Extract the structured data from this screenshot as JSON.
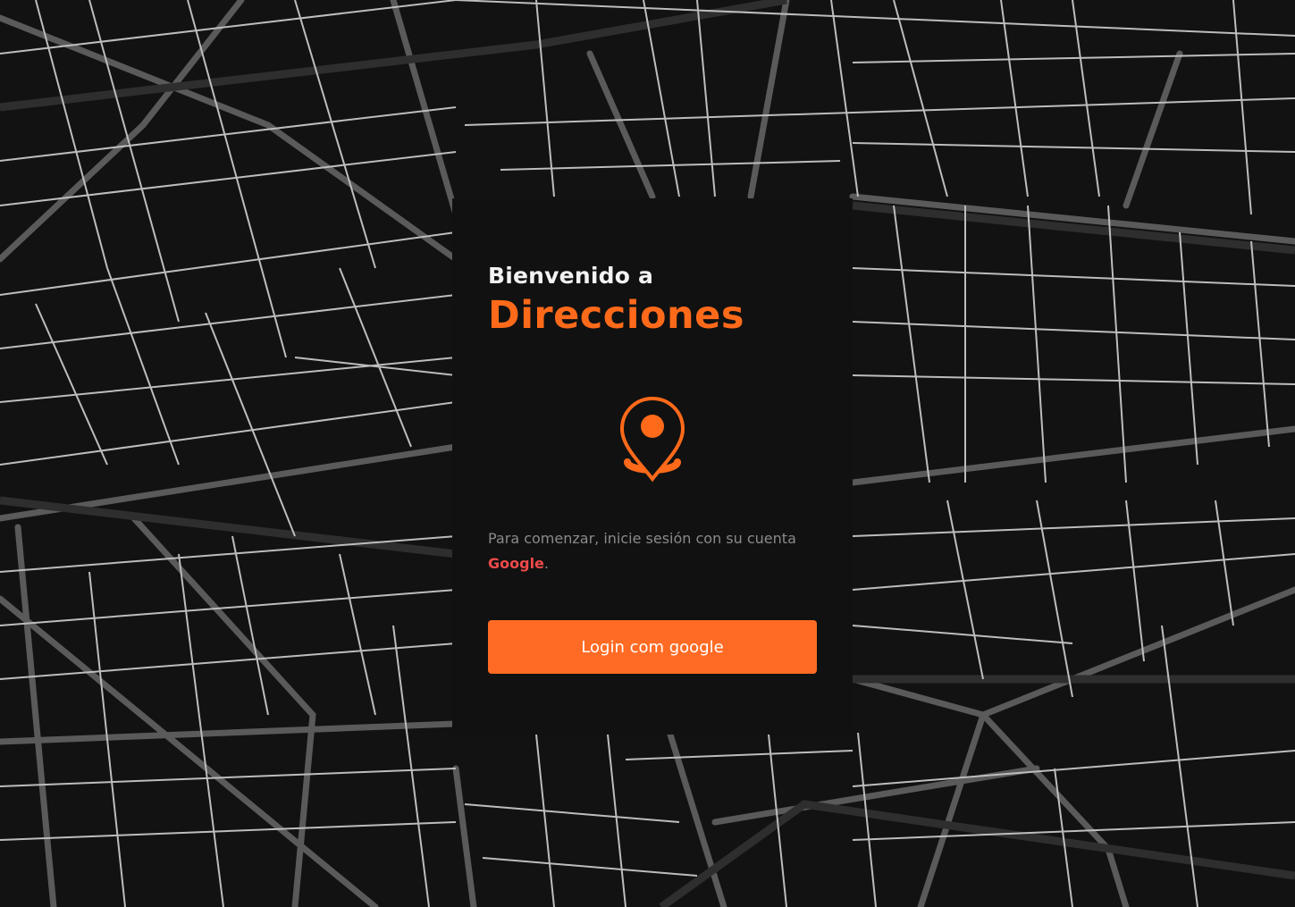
{
  "welcome": {
    "line1": "Bienvenido a",
    "app_name": "Direcciones"
  },
  "description": {
    "text": "Para comenzar, inicie sesión con su cuenta",
    "provider": "Google",
    "suffix": "."
  },
  "login_button": {
    "label": "Login com google"
  },
  "icons": {
    "logo": "map-pin-icon"
  },
  "colors": {
    "accent": "#ff6b24",
    "brand_text": "#ff6a1a",
    "link": "#f04a4a",
    "card_bg": "#111111",
    "map_bg": "#121212",
    "map_roads": "#bdbdbd"
  }
}
